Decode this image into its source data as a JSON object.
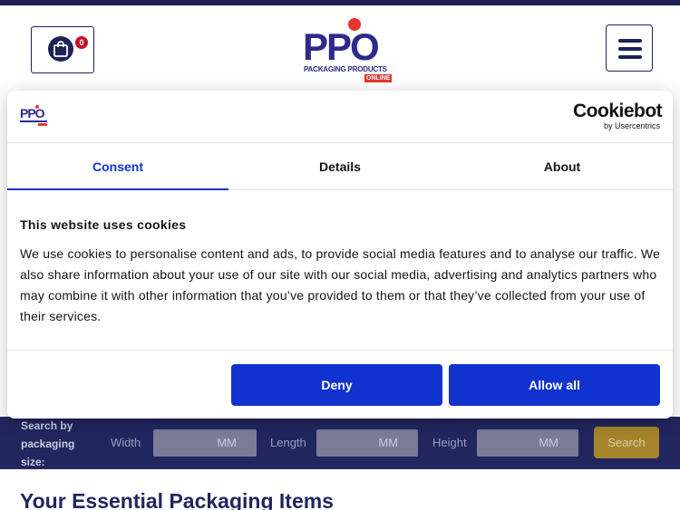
{
  "header": {
    "cart_count": "0",
    "logo_text": "PPO",
    "logo_sub": "PACKAGING PRODUCTS",
    "logo_online": "ONLINE"
  },
  "cookie_dialog": {
    "brand_name": "Cookiebot",
    "brand_by": "by Usercentrics",
    "tabs": [
      {
        "label": "Consent"
      },
      {
        "label": "Details"
      },
      {
        "label": "About"
      }
    ],
    "title": "This website uses cookies",
    "body": "We use cookies to personalise content and ads, to provide social media features and to analyse our traffic. We also share information about your use of our site with our social media, advertising and analytics partners who may combine it with other information that you’ve provided to them or that they’ve collected from your use of their services.",
    "deny_label": "Deny",
    "allow_label": "Allow all"
  },
  "search": {
    "label": "Search by packaging size:",
    "fields": [
      {
        "label": "Width",
        "unit": "MM"
      },
      {
        "label": "Length",
        "unit": "MM"
      },
      {
        "label": "Height",
        "unit": "MM"
      }
    ],
    "button_label": "Search"
  },
  "main": {
    "section_title": "Your Essential Packaging Items"
  },
  "colors": {
    "brand_navy": "#1e2255",
    "cookiebot_blue": "#1032cf",
    "logo_red": "#e4362f",
    "logo_yellow": "#f5c400"
  }
}
